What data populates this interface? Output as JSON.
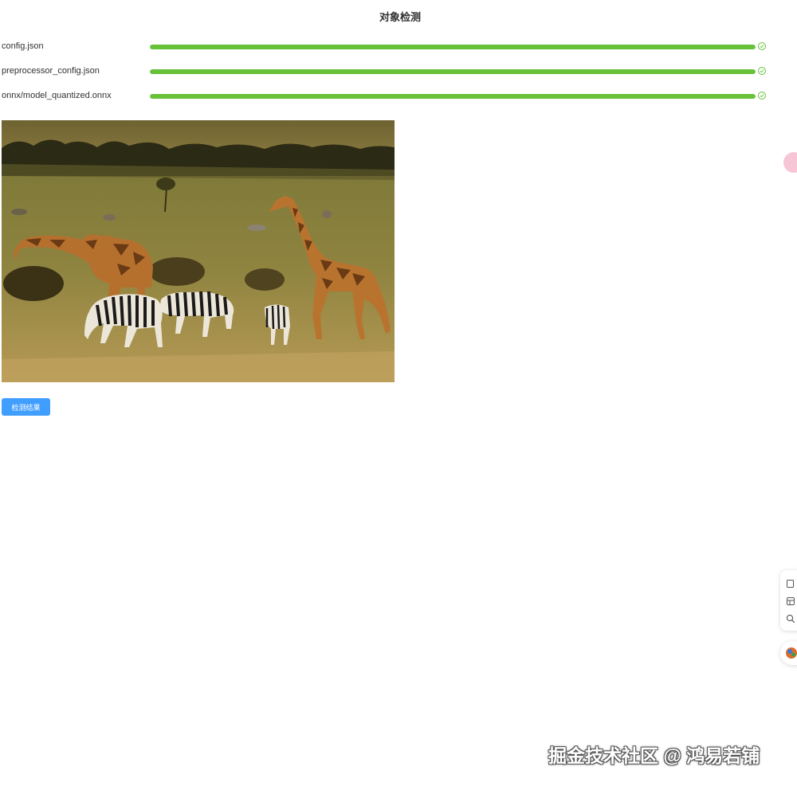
{
  "title": "对象检测",
  "files": [
    {
      "name": "config.json",
      "progress": 100,
      "status_icon": "check-circle-icon"
    },
    {
      "name": "preprocessor_config.json",
      "progress": 100,
      "status_icon": "check-circle-icon"
    },
    {
      "name": "onnx/model_quantized.onnx",
      "progress": 100,
      "status_icon": "check-circle-icon"
    }
  ],
  "image": {
    "subject": "giraffes-and-zebras-savanna-photo"
  },
  "detect_button_label": "检测结果",
  "watermark": "掘金技术社区 @ 鸿易若铺",
  "colors": {
    "progress": "#67c23a",
    "button": "#409eff",
    "title": "#303133"
  },
  "side_tools": [
    "copy-icon",
    "layout-icon",
    "search-icon"
  ]
}
